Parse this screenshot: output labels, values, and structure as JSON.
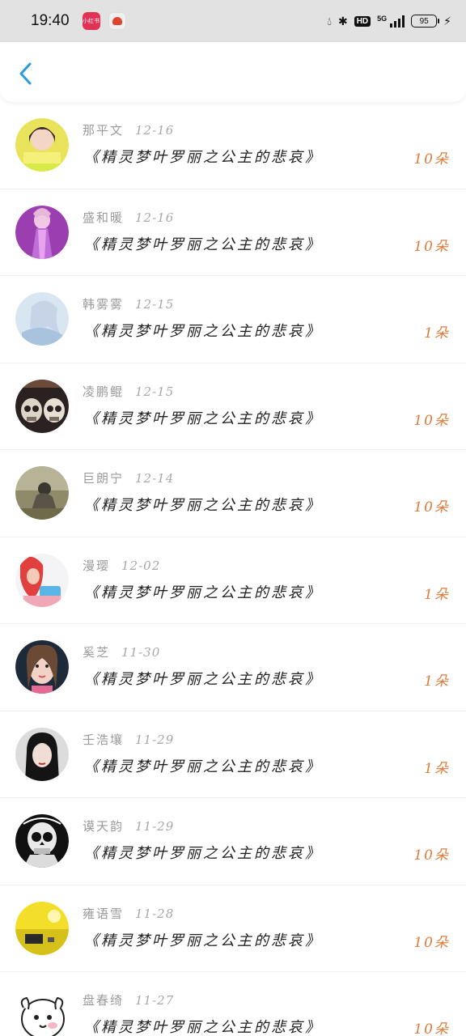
{
  "status_bar": {
    "time": "19:40",
    "app1_label": "小红书",
    "hd": "HD",
    "network": "5G",
    "battery": "95"
  },
  "header": {
    "back_icon": "chevron-left-icon",
    "accent_color": "#2a9be0"
  },
  "records": [
    {
      "name": "那平文",
      "date": "12-16",
      "title": "《精灵梦叶罗丽之公主的悲哀》",
      "count": "10朵"
    },
    {
      "name": "盛和暖",
      "date": "12-16",
      "title": "《精灵梦叶罗丽之公主的悲哀》",
      "count": "10朵"
    },
    {
      "name": "韩雾雾",
      "date": "12-15",
      "title": "《精灵梦叶罗丽之公主的悲哀》",
      "count": "1朵"
    },
    {
      "name": "凌鹏鲲",
      "date": "12-15",
      "title": "《精灵梦叶罗丽之公主的悲哀》",
      "count": "10朵"
    },
    {
      "name": "巨朗宁",
      "date": "12-14",
      "title": "《精灵梦叶罗丽之公主的悲哀》",
      "count": "10朵"
    },
    {
      "name": "漫璎",
      "date": "12-02",
      "title": "《精灵梦叶罗丽之公主的悲哀》",
      "count": "1朵"
    },
    {
      "name": "奚芝",
      "date": "11-30",
      "title": "《精灵梦叶罗丽之公主的悲哀》",
      "count": "1朵"
    },
    {
      "name": "壬浩壤",
      "date": "11-29",
      "title": "《精灵梦叶罗丽之公主的悲哀》",
      "count": "1朵"
    },
    {
      "name": "谟天韵",
      "date": "11-29",
      "title": "《精灵梦叶罗丽之公主的悲哀》",
      "count": "10朵"
    },
    {
      "name": "雍语雪",
      "date": "11-28",
      "title": "《精灵梦叶罗丽之公主的悲哀》",
      "count": "10朵"
    },
    {
      "name": "盘春绮",
      "date": "11-27",
      "title": "《精灵梦叶罗丽之公主的悲哀》",
      "count": "10朵"
    }
  ],
  "colors": {
    "count_color": "#e07b39",
    "name_color": "#9a9a9a",
    "title_color": "#222222"
  }
}
